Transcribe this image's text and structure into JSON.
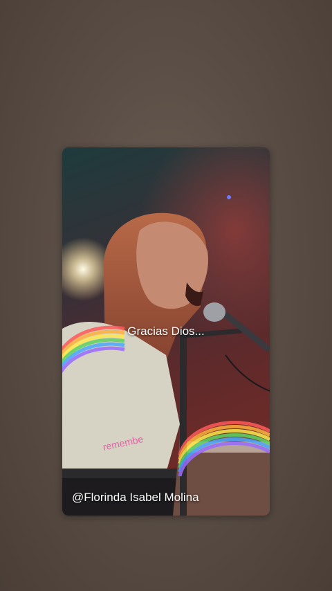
{
  "story": {
    "caption": "Gracias Dios...",
    "credit": "@Florinda Isabel Molina",
    "watermark": "remembe"
  },
  "colors": {
    "background": "#5a4e46",
    "caption_text": "#ffffff",
    "watermark": "#e0409a"
  }
}
